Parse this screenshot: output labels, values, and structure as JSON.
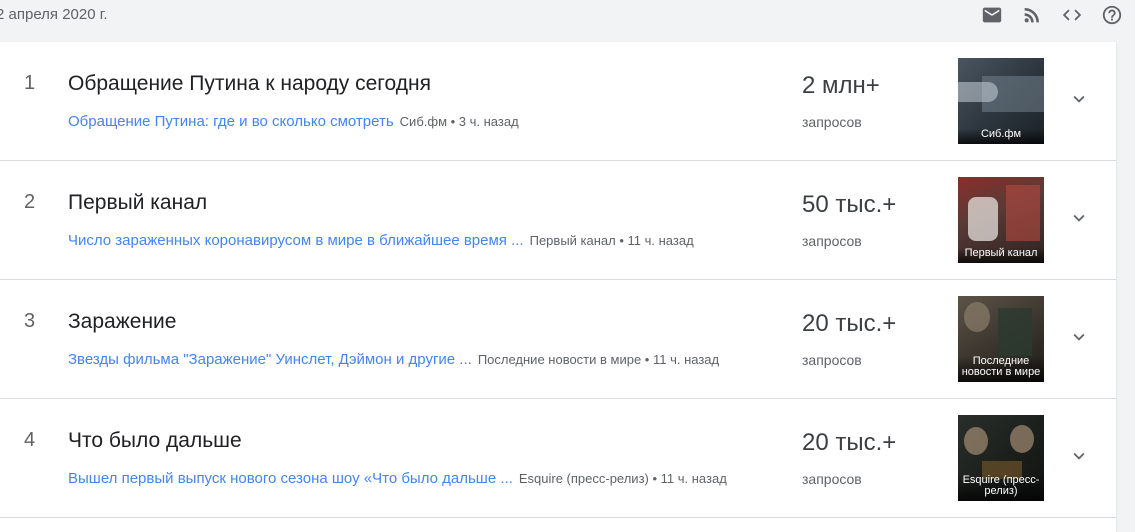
{
  "header": {
    "date": "2 апреля 2020 г.",
    "tools": [
      {
        "icon": "mail-icon"
      },
      {
        "icon": "rss-icon"
      },
      {
        "icon": "embed-code-icon"
      },
      {
        "icon": "help-icon"
      }
    ]
  },
  "items": [
    {
      "rank": "1",
      "title": "Обращение Путина к народу сегодня",
      "article": "Обращение Путина: где и во сколько смотреть",
      "source_time": "Сиб.фм • 3 ч. назад",
      "count": "2 млн+",
      "count_label": "запросов",
      "thumb_caption": "Сиб.фм"
    },
    {
      "rank": "2",
      "title": "Первый канал",
      "article": "Число зараженных коронавирусом в мире в ближайшее время ...",
      "source_time": "Первый канал • 11 ч. назад",
      "count": "50 тыс.+",
      "count_label": "запросов",
      "thumb_caption": "Первый канал"
    },
    {
      "rank": "3",
      "title": "Заражение",
      "article": "Звезды фильма \"Заражение\" Уинслет, Дэймон и другие ...",
      "source_time": "Последние новости в мире • 11 ч. назад",
      "count": "20 тыс.+",
      "count_label": "запросов",
      "thumb_caption": "Последние новости в мире"
    },
    {
      "rank": "4",
      "title": "Что было дальше",
      "article": "Вышел первый выпуск нового сезона шоу «Что было дальше ...",
      "source_time": "Esquire (пресс-релиз) • 11 ч. назад",
      "count": "20 тыс.+",
      "count_label": "запросов",
      "thumb_caption": "Esquire (пресс-релиз)"
    }
  ],
  "colors": {
    "link": "#4285f4",
    "title": "#202124",
    "muted": "#5f6368",
    "background": "#f1f3f4"
  }
}
